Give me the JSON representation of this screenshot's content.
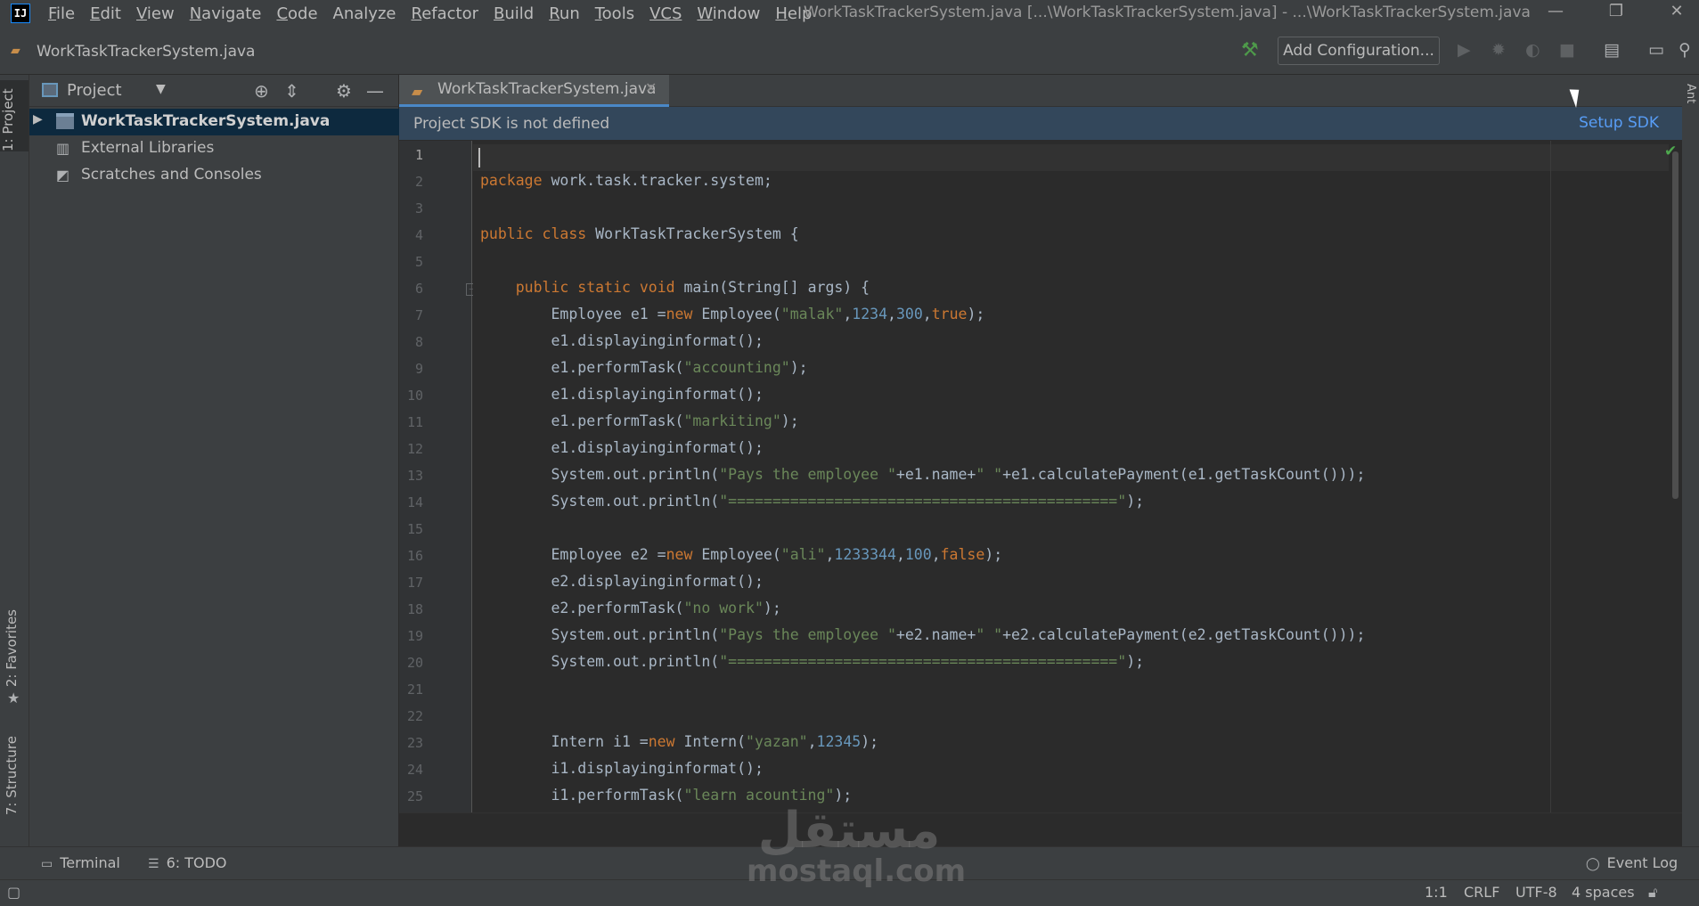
{
  "menubar": {
    "logo": "IJ",
    "items": [
      {
        "label": "File",
        "mnemonic": "F",
        "rest": "ile"
      },
      {
        "label": "Edit",
        "mnemonic": "E",
        "rest": "dit"
      },
      {
        "label": "View",
        "mnemonic": "V",
        "rest": "iew"
      },
      {
        "label": "Navigate",
        "mnemonic": "N",
        "rest": "avigate"
      },
      {
        "label": "Code",
        "mnemonic": "C",
        "rest": "ode"
      },
      {
        "label": "Analyze",
        "mnemonic": "",
        "rest": "Analyze"
      },
      {
        "label": "Refactor",
        "mnemonic": "R",
        "rest": "efactor"
      },
      {
        "label": "Build",
        "mnemonic": "B",
        "rest": "uild"
      },
      {
        "label": "Run",
        "mnemonic": "R",
        "rest": "un"
      },
      {
        "label": "Tools",
        "mnemonic": "T",
        "rest": "ools"
      },
      {
        "label": "VCS",
        "mnemonic": "VCS",
        "rest": ""
      },
      {
        "label": "Window",
        "mnemonic": "W",
        "rest": "indow"
      },
      {
        "label": "Help",
        "mnemonic": "H",
        "rest": "elp"
      }
    ],
    "window_title": "WorkTaskTrackerSystem.java [...\\WorkTaskTrackerSystem.java] - ...\\WorkTaskTrackerSystem.java",
    "minimize": "—",
    "restore": "❐",
    "close": "✕"
  },
  "navbar": {
    "file_label": "WorkTaskTrackerSystem.java",
    "add_configuration": "Add Configuration..."
  },
  "left_strip": {
    "project_tab": "1: Project",
    "favorites_tab": "2: Favorites",
    "structure_tab": "7: Structure"
  },
  "project_panel": {
    "title": "Project",
    "tree": [
      {
        "label": "WorkTaskTrackerSystem.java",
        "selected": true
      },
      {
        "label": "External Libraries"
      },
      {
        "label": "Scratches and Consoles"
      }
    ]
  },
  "editor": {
    "tab_label": "WorkTaskTrackerSystem.java",
    "banner_message": "Project SDK is not defined",
    "banner_link": "Setup SDK",
    "line_numbers": [
      "1",
      "2",
      "3",
      "4",
      "5",
      "6",
      "7",
      "8",
      "9",
      "10",
      "11",
      "12",
      "13",
      "14",
      "15",
      "16",
      "17",
      "18",
      "19",
      "20",
      "21",
      "22",
      "23",
      "24",
      "25"
    ]
  },
  "right_strip": {
    "ant_tab": "Ant"
  },
  "bottom_tools": {
    "terminal": "Terminal",
    "todo": "6: TODO",
    "event_log": "Event Log"
  },
  "status": {
    "position": "1:1",
    "line_sep": "CRLF",
    "encoding": "UTF-8",
    "indent": "4 spaces"
  },
  "watermark": {
    "arabic": "مستقل",
    "latin": "mostaql.com"
  },
  "colors": {
    "keyword": "#cc7832",
    "string": "#6a8759",
    "number": "#6897bb",
    "text": "#a9b7c6",
    "banner": "#33475b",
    "link": "#589df6",
    "selection": "#0d293e"
  }
}
